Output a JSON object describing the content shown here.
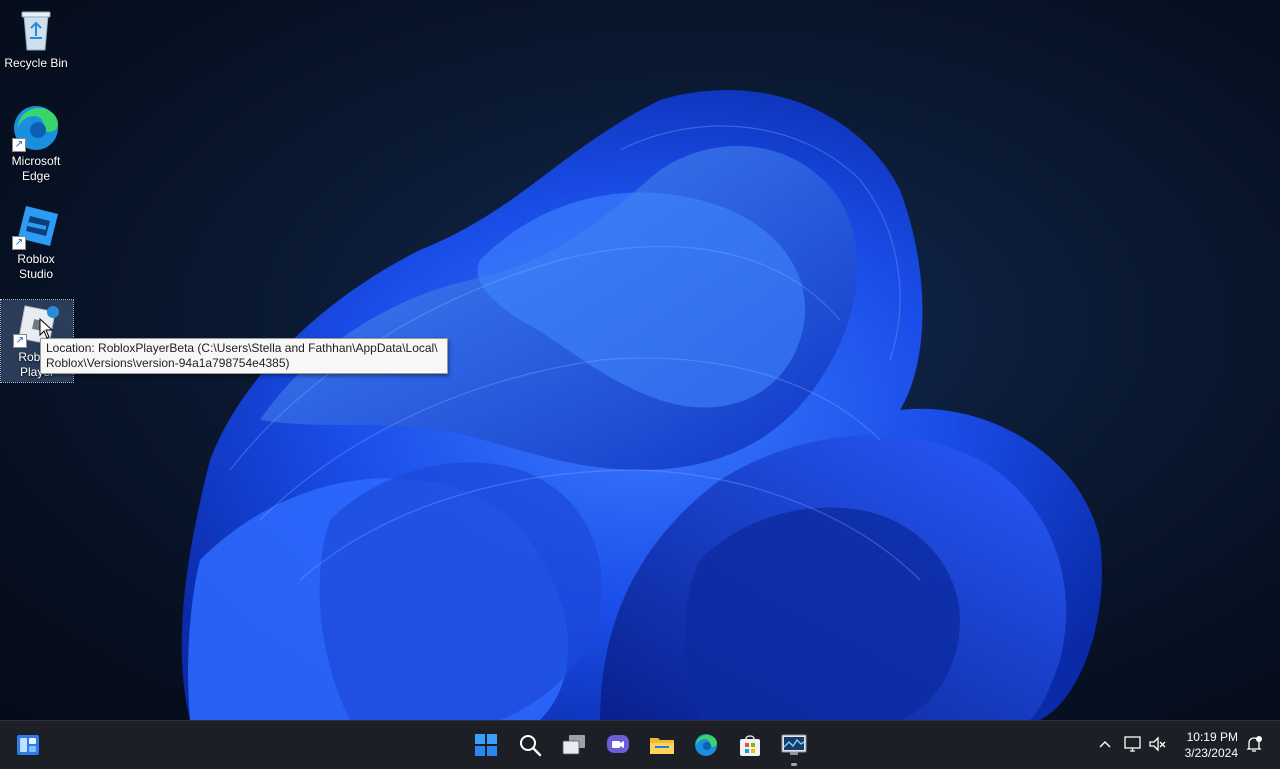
{
  "desktop": {
    "icons": [
      {
        "label": "Recycle Bin"
      },
      {
        "label": "Microsoft Edge"
      },
      {
        "label": "Roblox Studio"
      },
      {
        "label": "Roblox Player"
      }
    ],
    "tooltip": {
      "line1": "Location: RobloxPlayerBeta (C:\\Users\\Stella and Fathhan\\AppData\\Local\\",
      "line2": "Roblox\\Versions\\version-94a1a798754e4385)"
    }
  },
  "taskbar": {
    "apps": [
      "start-icon",
      "search-icon",
      "task-view-icon",
      "chat-icon",
      "file-explorer-icon",
      "edge-icon",
      "store-icon",
      "performance-monitor-icon"
    ],
    "clock": {
      "time": "10:19 PM",
      "date": "3/23/2024"
    }
  },
  "colors": {
    "accent": "#1f5fff",
    "taskbar": "#1c1f25"
  }
}
